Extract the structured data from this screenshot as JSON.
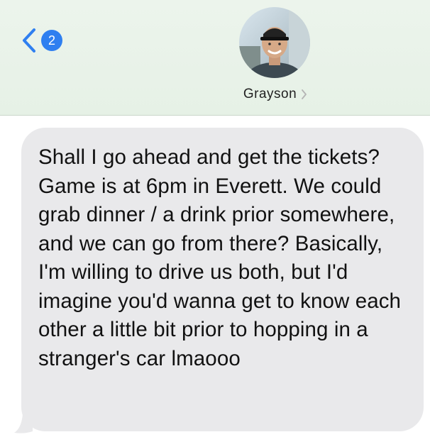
{
  "header": {
    "back_badge": "2",
    "contact_name": "Grayson",
    "back_icon": "chevron-left-icon",
    "contact_chevron_icon": "chevron-right-icon"
  },
  "colors": {
    "header_bg": "#e6f1e6",
    "accent_blue": "#2f7ff0",
    "bubble_bg": "#e9e9eb"
  },
  "message": {
    "sender": "incoming",
    "text": "Shall I go ahead and get the tickets? Game is at 6pm in Everett. We could grab dinner / a drink prior somewhere, and we can go from there? Basically, I'm willing to drive us both, but I'd imagine you'd wanna get to know each other a little bit prior to hopping in a stranger's car lmaooo"
  }
}
